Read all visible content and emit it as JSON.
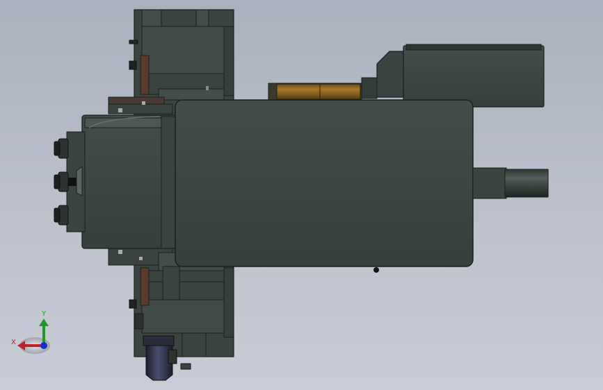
{
  "viewport": {
    "background_top": "#aab0bd",
    "background_bottom": "#c9ccd6"
  },
  "model": {
    "body_color": "#3d4642",
    "edge_color": "#1b1f1d",
    "accent_color": "#8a6420",
    "connector_color": "#2c2f44"
  },
  "triad": {
    "x_label": "X",
    "y_label": "Y",
    "x_color": "#c0202a",
    "y_color": "#1f9a2a",
    "z_color": "#1f2bd0"
  }
}
